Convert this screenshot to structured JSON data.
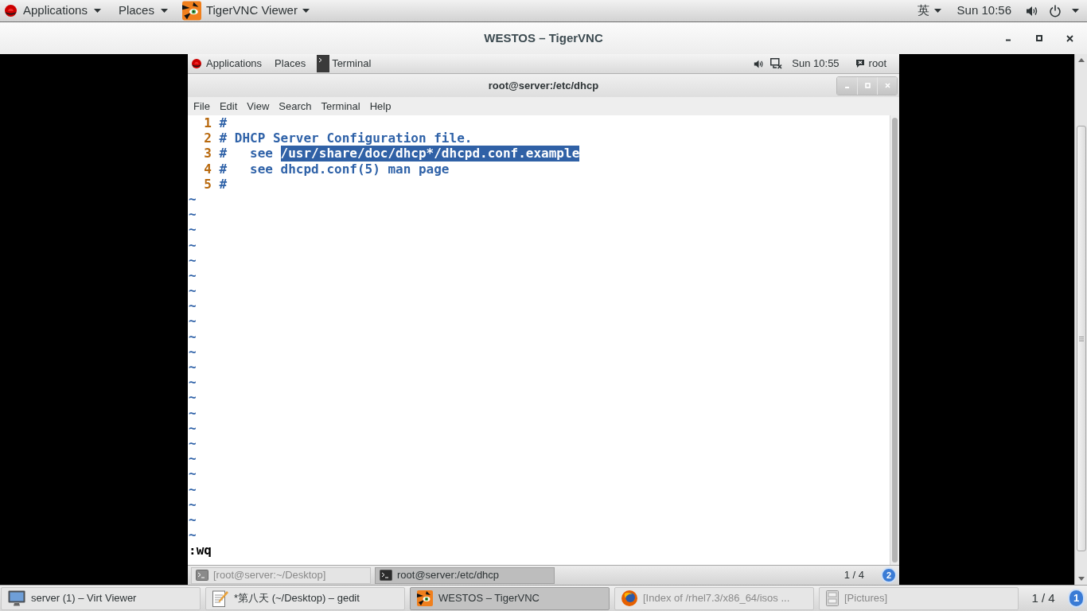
{
  "host_top_bar": {
    "applications_menu": "Applications",
    "places_menu": "Places",
    "app_menu": "TigerVNC Viewer",
    "input_method": "英",
    "clock": "Sun 10:56"
  },
  "vnc_window": {
    "title": "WESTOS – TigerVNC"
  },
  "remote_top_bar": {
    "applications_menu": "Applications",
    "places_menu": "Places",
    "app_menu": "Terminal",
    "clock": "Sun 10:55",
    "user": "root"
  },
  "terminal": {
    "title": "root@server:/etc/dhcp",
    "menu": [
      "File",
      "Edit",
      "View",
      "Search",
      "Terminal",
      "Help"
    ],
    "lines": [
      {
        "number": "1",
        "segments": [
          {
            "text": "#",
            "highlighted": false
          }
        ]
      },
      {
        "number": "2",
        "segments": [
          {
            "text": "# DHCP Server Configuration file.",
            "highlighted": false
          }
        ]
      },
      {
        "number": "3",
        "segments": [
          {
            "text": "#   see ",
            "highlighted": false
          },
          {
            "text": "/usr/share/doc/dhcp*/dhcpd.conf.example",
            "highlighted": true
          }
        ]
      },
      {
        "number": "4",
        "segments": [
          {
            "text": "#   see dhcpd.conf(5) man page",
            "highlighted": false
          }
        ]
      },
      {
        "number": "5",
        "segments": [
          {
            "text": "#",
            "highlighted": false
          }
        ]
      }
    ],
    "empty_line_markers": [
      "~",
      "~",
      "~",
      "~",
      "~",
      "~",
      "~",
      "~",
      "~",
      "~",
      "~",
      "~",
      "~",
      "~",
      "~",
      "~",
      "~",
      "~",
      "~",
      "~",
      "~",
      "~",
      "~"
    ],
    "command_line": ":wq"
  },
  "remote_taskbar": {
    "tasks": [
      {
        "label": "[root@server:~/Desktop]",
        "selected": false,
        "minimized": true
      },
      {
        "label": "root@server:/etc/dhcp",
        "selected": true,
        "minimized": false
      }
    ],
    "workspace": "1 / 4",
    "workspace_number": "2"
  },
  "host_taskbar": {
    "tasks": [
      {
        "kind": "viewer",
        "label": "server (1) – Virt Viewer",
        "selected": false,
        "minimized": false
      },
      {
        "kind": "editor",
        "label": "*第八天 (~/Desktop) – gedit",
        "selected": false,
        "minimized": false
      },
      {
        "kind": "vnc",
        "label": "WESTOS – TigerVNC",
        "selected": true,
        "minimized": false
      },
      {
        "kind": "browser",
        "label": "[Index of /rhel7.3/x86_64/isos ...",
        "selected": false,
        "minimized": true
      },
      {
        "kind": "files",
        "label": "[Pictures]",
        "selected": false,
        "minimized": true
      }
    ],
    "workspace": "1 / 4",
    "workspace_number": "1"
  }
}
